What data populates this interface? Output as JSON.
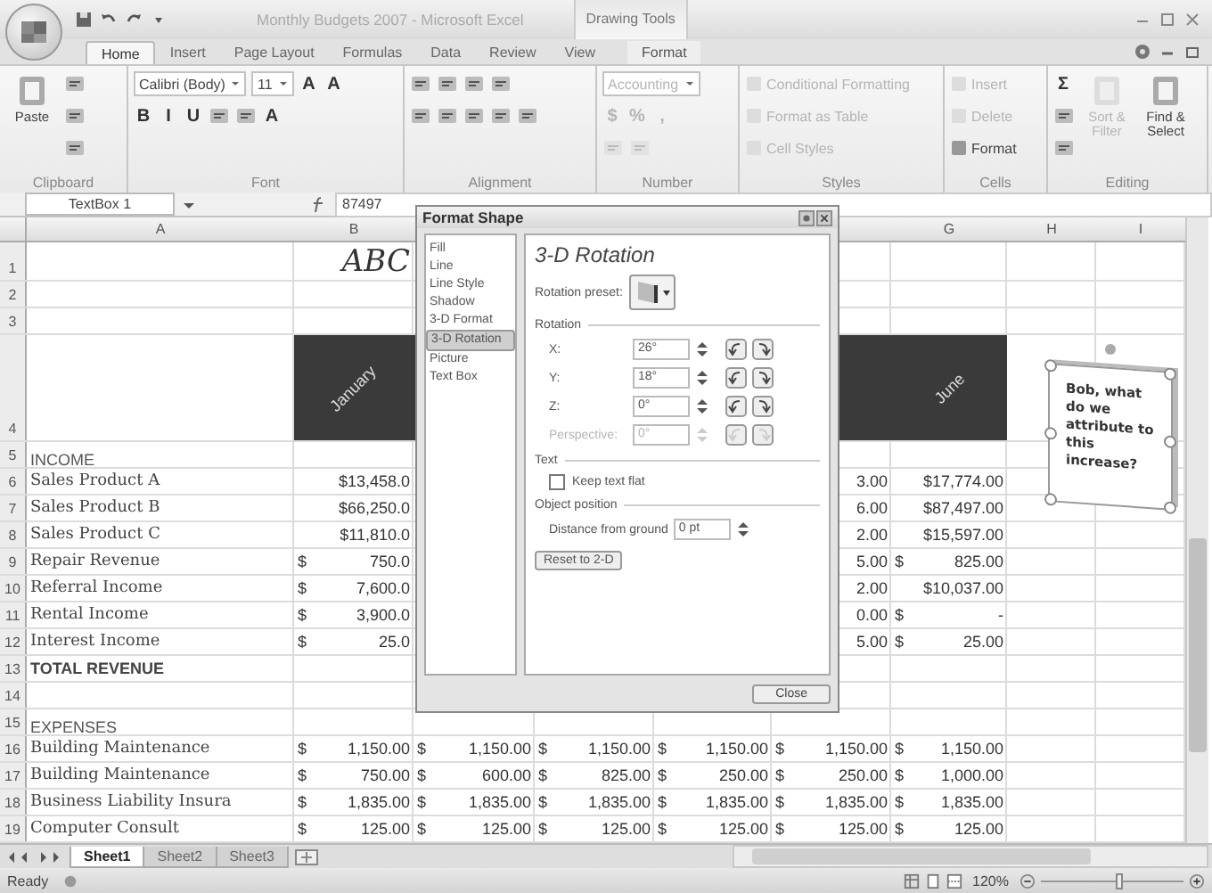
{
  "window": {
    "title": "Monthly Budgets 2007 - Microsoft Excel",
    "context_tab_group": "Drawing Tools"
  },
  "tabs": [
    {
      "label": "Home",
      "selected": true,
      "contextual": false
    },
    {
      "label": "Insert",
      "selected": false,
      "contextual": false
    },
    {
      "label": "Page Layout",
      "selected": false,
      "contextual": false
    },
    {
      "label": "Formulas",
      "selected": false,
      "contextual": false
    },
    {
      "label": "Data",
      "selected": false,
      "contextual": false
    },
    {
      "label": "Review",
      "selected": false,
      "contextual": false
    },
    {
      "label": "View",
      "selected": false,
      "contextual": false
    },
    {
      "label": "Format",
      "selected": false,
      "contextual": true
    }
  ],
  "ribbon": {
    "groups": [
      {
        "label": "Clipboard",
        "blocks": [
          {
            "kind": "large",
            "label": "Paste",
            "disabled": false
          },
          {
            "kind": "stack",
            "lines": [
              {
                "items": [
                  {
                    "kind": "icon",
                    "disabled": false
                  }
                ]
              },
              {
                "items": [
                  {
                    "kind": "icon",
                    "disabled": false
                  }
                ]
              },
              {
                "items": [
                  {
                    "kind": "icon",
                    "disabled": false
                  }
                ]
              }
            ]
          }
        ]
      },
      {
        "label": "Font",
        "blocks": [
          {
            "kind": "stack",
            "lines": [
              {
                "items": [
                  {
                    "kind": "combo",
                    "label": "Calibri (Body)",
                    "disabled": false
                  },
                  {
                    "kind": "combo",
                    "label": "11",
                    "disabled": false
                  },
                  {
                    "kind": "glyph",
                    "label": "A",
                    "disabled": false
                  },
                  {
                    "kind": "glyph",
                    "label": "A",
                    "disabled": false
                  }
                ]
              },
              {
                "items": [
                  {
                    "kind": "glyph",
                    "label": "B",
                    "disabled": false
                  },
                  {
                    "kind": "glyph",
                    "label": "I",
                    "disabled": false
                  },
                  {
                    "kind": "glyph",
                    "label": "U",
                    "disabled": false
                  },
                  {
                    "kind": "icon",
                    "disabled": false
                  },
                  {
                    "kind": "icon",
                    "disabled": false
                  },
                  {
                    "kind": "glyph",
                    "label": "A",
                    "disabled": false
                  }
                ]
              }
            ]
          }
        ]
      },
      {
        "label": "Alignment",
        "blocks": [
          {
            "kind": "stack",
            "lines": [
              {
                "items": [
                  {
                    "kind": "icon",
                    "disabled": false
                  },
                  {
                    "kind": "icon",
                    "disabled": false
                  },
                  {
                    "kind": "icon",
                    "disabled": false
                  },
                  {
                    "kind": "icon",
                    "disabled": false
                  }
                ]
              },
              {
                "items": [
                  {
                    "kind": "icon",
                    "disabled": false
                  },
                  {
                    "kind": "icon",
                    "disabled": false
                  },
                  {
                    "kind": "icon",
                    "disabled": false
                  },
                  {
                    "kind": "icon",
                    "disabled": false
                  },
                  {
                    "kind": "icon",
                    "disabled": false
                  }
                ]
              }
            ]
          }
        ]
      },
      {
        "label": "Number",
        "blocks": [
          {
            "kind": "stack",
            "lines": [
              {
                "items": [
                  {
                    "kind": "combo",
                    "label": "Accounting",
                    "disabled": true
                  }
                ]
              },
              {
                "items": [
                  {
                    "kind": "glyph",
                    "label": "$",
                    "disabled": true
                  },
                  {
                    "kind": "glyph",
                    "label": "%",
                    "disabled": true
                  },
                  {
                    "kind": "glyph",
                    "label": ",",
                    "disabled": true
                  }
                ]
              },
              {
                "items": [
                  {
                    "kind": "icon",
                    "disabled": true
                  },
                  {
                    "kind": "icon",
                    "disabled": true
                  }
                ]
              }
            ]
          }
        ]
      },
      {
        "label": "Styles",
        "blocks": [
          {
            "kind": "stack",
            "lines": [
              {
                "items": [
                  {
                    "kind": "small",
                    "label": "Conditional Formatting",
                    "disabled": true
                  }
                ]
              },
              {
                "items": [
                  {
                    "kind": "small",
                    "label": "Format as Table",
                    "disabled": true
                  }
                ]
              },
              {
                "items": [
                  {
                    "kind": "small",
                    "label": "Cell Styles",
                    "disabled": true
                  }
                ]
              }
            ]
          }
        ]
      },
      {
        "label": "Cells",
        "blocks": [
          {
            "kind": "stack",
            "lines": [
              {
                "items": [
                  {
                    "kind": "small",
                    "label": "Insert",
                    "disabled": true
                  }
                ]
              },
              {
                "items": [
                  {
                    "kind": "small",
                    "label": "Delete",
                    "disabled": true
                  }
                ]
              },
              {
                "items": [
                  {
                    "kind": "small",
                    "label": "Format",
                    "disabled": false
                  }
                ]
              }
            ]
          }
        ]
      },
      {
        "label": "Editing",
        "blocks": [
          {
            "kind": "stack",
            "lines": [
              {
                "items": [
                  {
                    "kind": "glyph",
                    "label": "Σ",
                    "disabled": false
                  }
                ]
              },
              {
                "items": [
                  {
                    "kind": "icon",
                    "disabled": false
                  }
                ]
              },
              {
                "items": [
                  {
                    "kind": "icon",
                    "disabled": false
                  }
                ]
              }
            ]
          },
          {
            "kind": "large",
            "label": "Sort & Filter",
            "disabled": true
          },
          {
            "kind": "large",
            "label": "Find & Select",
            "disabled": false
          }
        ]
      }
    ]
  },
  "formula_bar": {
    "name_box": "TextBox 1",
    "formula": "87497"
  },
  "sheet": {
    "columns": [
      {
        "label": "A"
      },
      {
        "label": "B"
      },
      {
        "label": "G"
      },
      {
        "label": "H"
      },
      {
        "label": "I"
      }
    ],
    "rows": [
      {
        "num": "1",
        "kind": "title",
        "cells": {
          "B": {
            "text": "ABC"
          }
        }
      },
      {
        "num": "2",
        "kind": "blank"
      },
      {
        "num": "3",
        "kind": "blank"
      },
      {
        "num": "4",
        "kind": "months",
        "cells": {
          "B": {
            "text": "January"
          },
          "G": {
            "text": "June"
          }
        }
      },
      {
        "num": "5",
        "kind": "section",
        "label": "INCOME"
      },
      {
        "num": "6",
        "kind": "item",
        "label": "Sales Product A",
        "cells": {
          "B": {
            "text": "$13,458.0"
          },
          "F": {
            "text": "3.00"
          },
          "G": {
            "text": "$17,774.00"
          }
        }
      },
      {
        "num": "7",
        "kind": "item",
        "label": "Sales Product B",
        "cells": {
          "B": {
            "text": "$66,250.0"
          },
          "F": {
            "text": "6.00"
          },
          "G": {
            "text": "$87,497.00"
          }
        }
      },
      {
        "num": "8",
        "kind": "item",
        "label": "Sales Product C",
        "cells": {
          "B": {
            "text": "$11,810.0"
          },
          "F": {
            "text": "2.00"
          },
          "G": {
            "text": "$15,597.00"
          }
        }
      },
      {
        "num": "9",
        "kind": "item",
        "label": "Repair Revenue",
        "cells": {
          "B": {
            "currency": "$",
            "amount": "750.0"
          },
          "F": {
            "text": "5.00"
          },
          "G": {
            "currency": "$",
            "amount": "825.00"
          }
        }
      },
      {
        "num": "10",
        "kind": "item",
        "label": "Referral Income",
        "cells": {
          "B": {
            "currency": "$",
            "amount": "7,600.0"
          },
          "F": {
            "text": "2.00"
          },
          "G": {
            "text": "$10,037.00"
          }
        }
      },
      {
        "num": "11",
        "kind": "item",
        "label": "Rental Income",
        "cells": {
          "B": {
            "currency": "$",
            "amount": "3,900.0"
          },
          "F": {
            "text": "0.00"
          },
          "G": {
            "currency": "$",
            "amount": "-"
          }
        }
      },
      {
        "num": "12",
        "kind": "item",
        "label": "Interest Income",
        "cells": {
          "B": {
            "currency": "$",
            "amount": "25.0"
          },
          "F": {
            "text": "5.00"
          },
          "G": {
            "currency": "$",
            "amount": "25.00"
          }
        }
      },
      {
        "num": "13",
        "kind": "total",
        "label": "TOTAL REVENUE"
      },
      {
        "num": "14",
        "kind": "blank"
      },
      {
        "num": "15",
        "kind": "section",
        "label": "EXPENSES"
      },
      {
        "num": "16",
        "kind": "item",
        "label": "Building Maintenance",
        "cells": {
          "B": {
            "currency": "$",
            "amount": "1,150.00"
          },
          "C": {
            "currency": "$",
            "amount": "1,150.00"
          },
          "D": {
            "currency": "$",
            "amount": "1,150.00"
          },
          "E": {
            "currency": "$",
            "amount": "1,150.00"
          },
          "F": {
            "currency": "$",
            "amount": "1,150.00"
          },
          "G": {
            "currency": "$",
            "amount": "1,150.00"
          }
        }
      },
      {
        "num": "17",
        "kind": "item",
        "label": "Building Maintenance",
        "cells": {
          "B": {
            "currency": "$",
            "amount": "750.00"
          },
          "C": {
            "currency": "$",
            "amount": "600.00"
          },
          "D": {
            "currency": "$",
            "amount": "825.00"
          },
          "E": {
            "currency": "$",
            "amount": "250.00"
          },
          "F": {
            "currency": "$",
            "amount": "250.00"
          },
          "G": {
            "currency": "$",
            "amount": "1,000.00"
          }
        }
      },
      {
        "num": "18",
        "kind": "item",
        "label": "Business Liability Insura",
        "cells": {
          "B": {
            "currency": "$",
            "amount": "1,835.00"
          },
          "C": {
            "currency": "$",
            "amount": "1,835.00"
          },
          "D": {
            "currency": "$",
            "amount": "1,835.00"
          },
          "E": {
            "currency": "$",
            "amount": "1,835.00"
          },
          "F": {
            "currency": "$",
            "amount": "1,835.00"
          },
          "G": {
            "currency": "$",
            "amount": "1,835.00"
          }
        }
      },
      {
        "num": "19",
        "kind": "item",
        "label": "Computer Consult",
        "cells": {
          "B": {
            "currency": "$",
            "amount": "125.00"
          },
          "C": {
            "currency": "$",
            "amount": "125.00"
          },
          "D": {
            "currency": "$",
            "amount": "125.00"
          },
          "E": {
            "currency": "$",
            "amount": "125.00"
          },
          "F": {
            "currency": "$",
            "amount": "125.00"
          },
          "G": {
            "currency": "$",
            "amount": "125.00"
          }
        }
      }
    ],
    "text_box": {
      "text": "Bob, what do we attribute to this increase?"
    },
    "sheet_tabs": [
      {
        "label": "Sheet1",
        "selected": true
      },
      {
        "label": "Sheet2",
        "selected": false
      },
      {
        "label": "Sheet3",
        "selected": false
      }
    ]
  },
  "dialog": {
    "title": "Format Shape",
    "categories": [
      {
        "label": "Fill",
        "selected": false
      },
      {
        "label": "Line",
        "selected": false
      },
      {
        "label": "Line Style",
        "selected": false
      },
      {
        "label": "Shadow",
        "selected": false
      },
      {
        "label": "3-D Format",
        "selected": false
      },
      {
        "label": "3-D Rotation",
        "selected": true
      },
      {
        "label": "Picture",
        "selected": false
      },
      {
        "label": "Text Box",
        "selected": false
      }
    ],
    "heading": "3-D Rotation",
    "preset_label": "Rotation preset:",
    "rotation": {
      "title": "Rotation",
      "fields": [
        {
          "label": "X:",
          "value": "26°",
          "disabled": false
        },
        {
          "label": "Y:",
          "value": "18°",
          "disabled": false
        },
        {
          "label": "Z:",
          "value": "0°",
          "disabled": false
        },
        {
          "label": "Perspective:",
          "value": "0°",
          "disabled": true
        }
      ]
    },
    "text_section": {
      "title": "Text",
      "checkbox": {
        "label": "Keep text flat",
        "checked": false
      }
    },
    "position_section": {
      "title": "Object position",
      "field": {
        "label": "Distance from ground",
        "value": "0 pt"
      }
    },
    "reset_button": "Reset to 2-D",
    "close_button": "Close"
  },
  "status_bar": {
    "status": "Ready",
    "zoom": "120%",
    "level": 0.55
  }
}
